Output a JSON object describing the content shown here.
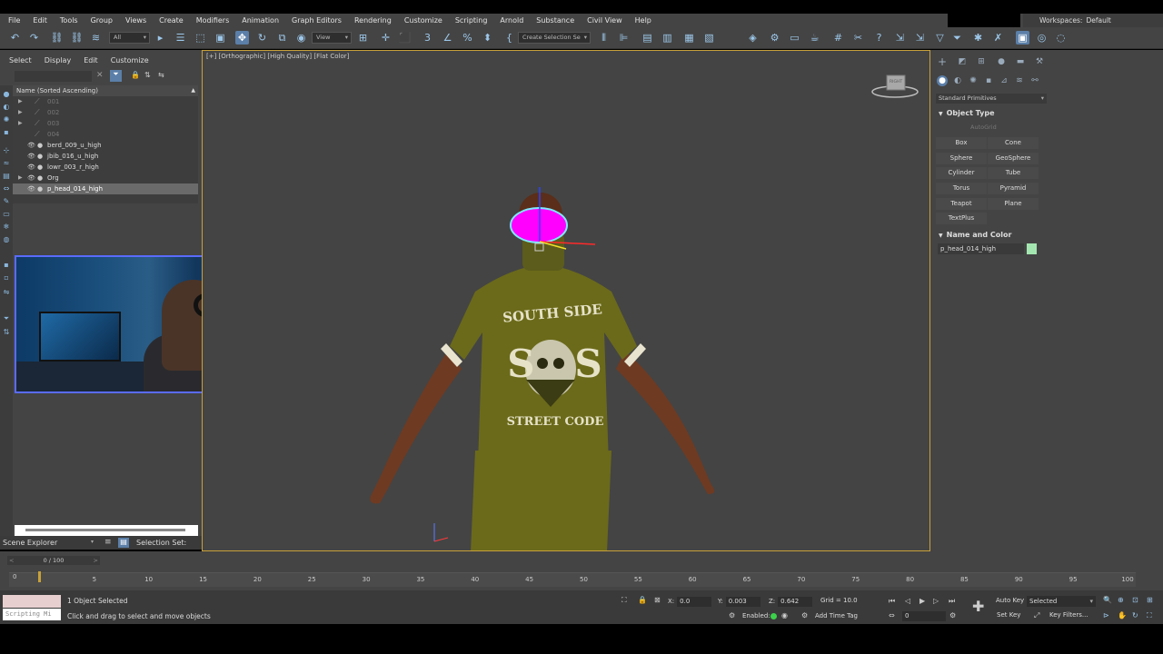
{
  "menubar": {
    "items": [
      "File",
      "Edit",
      "Tools",
      "Group",
      "Views",
      "Create",
      "Modifiers",
      "Animation",
      "Graph Editors",
      "Rendering",
      "Customize",
      "Scripting",
      "Arnold",
      "Substance",
      "Civil View",
      "Help"
    ],
    "workspace_label": "Workspaces:",
    "workspace_value": "Default"
  },
  "toolbar": {
    "selection_filter": "All",
    "view_dropdown": "View",
    "named_selection_placeholder": "Create Selection Se"
  },
  "scene_explorer": {
    "tabs": [
      "Select",
      "Display",
      "Edit",
      "Customize"
    ],
    "column_header": "Name (Sorted Ascending)",
    "items": [
      {
        "name": "001",
        "type": "bone",
        "visible": false,
        "expandable": true
      },
      {
        "name": "002",
        "type": "bone",
        "visible": false,
        "expandable": true
      },
      {
        "name": "003",
        "type": "bone",
        "visible": false,
        "expandable": true
      },
      {
        "name": "004",
        "type": "bone",
        "visible": false,
        "expandable": false
      },
      {
        "name": "berd_009_u_high",
        "type": "mesh",
        "visible": true,
        "expandable": false
      },
      {
        "name": "jbib_016_u_high",
        "type": "mesh",
        "visible": true,
        "expandable": false
      },
      {
        "name": "lowr_003_r_high",
        "type": "mesh",
        "visible": true,
        "expandable": false
      },
      {
        "name": "Org",
        "type": "mesh",
        "visible": true,
        "expandable": true
      },
      {
        "name": "p_head_014_high",
        "type": "mesh",
        "visible": true,
        "expandable": false,
        "selected": true
      }
    ],
    "footer_label": "Scene Explorer",
    "selection_set_label": "Selection Set:"
  },
  "viewport": {
    "label": "[+] [Orthographic] [High Quality] [Flat Color]",
    "viewcube_label": "RIGHT",
    "shirt_text_top": "SOUTH SIDE",
    "shirt_text_mid": "S   S",
    "shirt_text_bottom": "STREET CODE",
    "colors": {
      "selection": "#ff00ff",
      "frame_border": "#c9a13a",
      "shirt": "#6b6a1a",
      "skin": "#6e3a22"
    }
  },
  "command_panel": {
    "category": "Standard Primitives",
    "object_type_title": "Object Type",
    "autogrid": "AutoGrid",
    "primitives": [
      "Box",
      "Cone",
      "Sphere",
      "GeoSphere",
      "Cylinder",
      "Tube",
      "Torus",
      "Pyramid",
      "Teapot",
      "Plane",
      "TextPlus"
    ],
    "name_color_title": "Name and Color",
    "object_name": "p_head_014_high",
    "object_color": "#a4e6b0"
  },
  "timeline": {
    "slider_text": "0 / 100",
    "start_mark": "0",
    "ticks": [
      "5",
      "10",
      "15",
      "20",
      "25",
      "30",
      "35",
      "40",
      "45",
      "50",
      "55",
      "60",
      "65",
      "70",
      "75",
      "80",
      "85",
      "90",
      "95",
      "100"
    ],
    "current_frame": 0
  },
  "statusbar": {
    "listener": "Scripting Mi",
    "selected_count": "1 Object Selected",
    "prompt": "Click and drag to select and move objects",
    "x_label": "X:",
    "x_value": "0.0",
    "y_label": "Y:",
    "y_value": "0.003",
    "z_label": "Z:",
    "z_value": "0.642",
    "grid": "Grid = 10.0",
    "enabled_label": "Enabled:",
    "add_time_tag": "Add Time Tag",
    "frame_value": "0",
    "auto_key": "Auto Key",
    "set_key": "Set Key",
    "key_mode": "Selected",
    "key_filters": "Key Filters..."
  }
}
